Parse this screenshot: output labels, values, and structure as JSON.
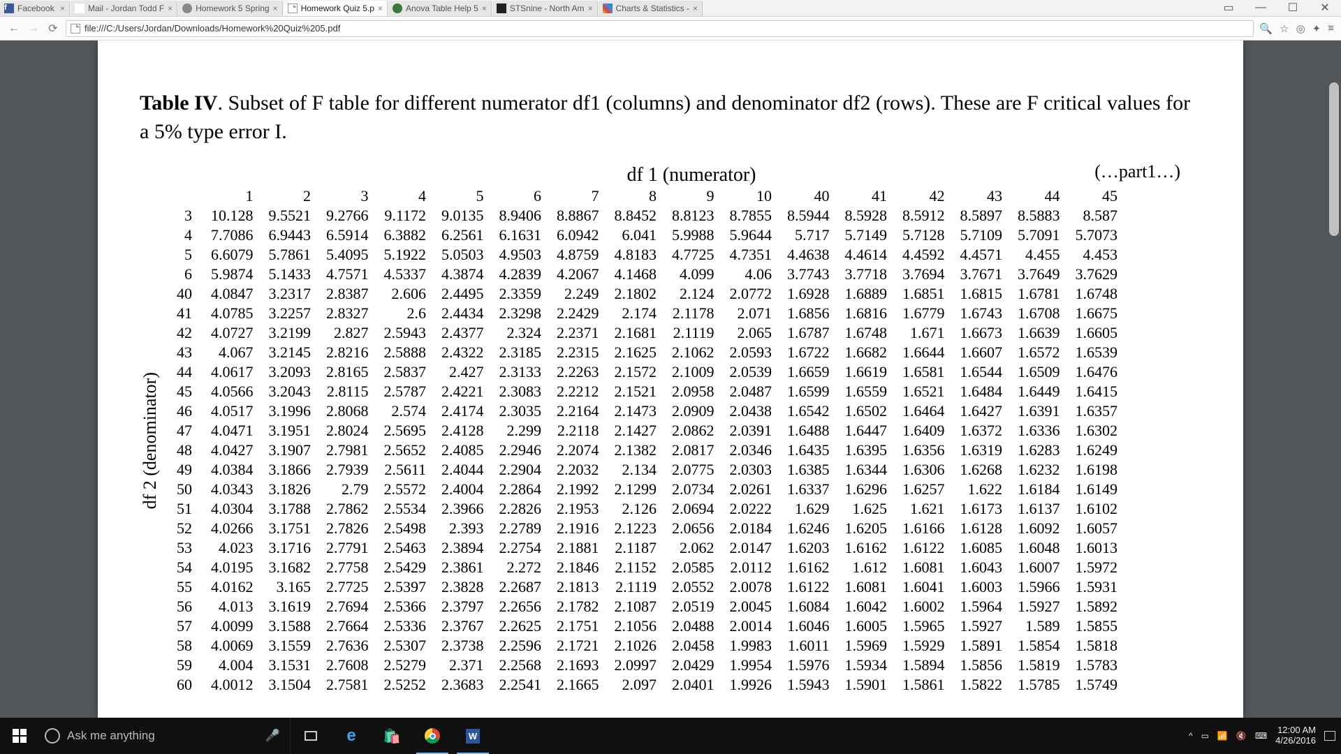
{
  "browser": {
    "tabs": [
      {
        "label": "Facebook",
        "icon": "facebook"
      },
      {
        "label": "Mail - Jordan Todd F",
        "icon": "mail"
      },
      {
        "label": "Homework 5 Spring",
        "icon": "gear"
      },
      {
        "label": "Homework Quiz 5.p",
        "icon": "page",
        "active": true
      },
      {
        "label": "Anova Table Help 5",
        "icon": "chegg"
      },
      {
        "label": "STSnine - North Am",
        "icon": "sts"
      },
      {
        "label": "Charts & Statistics -",
        "icon": "charts"
      }
    ],
    "url": "file:///C:/Users/Jordan/Downloads/Homework%20Quiz%205.pdf"
  },
  "document": {
    "title_bold": "Table IV",
    "title_rest": ". Subset of F table for different numerator df1 (columns) and denominator df2 (rows). These are F critical values for a 5% type error I.",
    "col_axis": "df 1 (numerator)",
    "row_axis": "df 2 (denominator)",
    "part_label": "(…part1…)"
  },
  "chart_data": {
    "type": "table",
    "title": "Subset of F table, 5% critical values",
    "col_headers": [
      "1",
      "2",
      "3",
      "4",
      "5",
      "6",
      "7",
      "8",
      "9",
      "10",
      "40",
      "41",
      "42",
      "43",
      "44",
      "45"
    ],
    "row_headers": [
      "3",
      "4",
      "5",
      "6",
      "40",
      "41",
      "42",
      "43",
      "44",
      "45",
      "46",
      "47",
      "48",
      "49",
      "50",
      "51",
      "52",
      "53",
      "54",
      "55",
      "56",
      "57",
      "58",
      "59",
      "60"
    ],
    "values": [
      [
        "10.128",
        "9.5521",
        "9.2766",
        "9.1172",
        "9.0135",
        "8.9406",
        "8.8867",
        "8.8452",
        "8.8123",
        "8.7855",
        "8.5944",
        "8.5928",
        "8.5912",
        "8.5897",
        "8.5883",
        "8.587"
      ],
      [
        "7.7086",
        "6.9443",
        "6.5914",
        "6.3882",
        "6.2561",
        "6.1631",
        "6.0942",
        "6.041",
        "5.9988",
        "5.9644",
        "5.717",
        "5.7149",
        "5.7128",
        "5.7109",
        "5.7091",
        "5.7073"
      ],
      [
        "6.6079",
        "5.7861",
        "5.4095",
        "5.1922",
        "5.0503",
        "4.9503",
        "4.8759",
        "4.8183",
        "4.7725",
        "4.7351",
        "4.4638",
        "4.4614",
        "4.4592",
        "4.4571",
        "4.455",
        "4.453"
      ],
      [
        "5.9874",
        "5.1433",
        "4.7571",
        "4.5337",
        "4.3874",
        "4.2839",
        "4.2067",
        "4.1468",
        "4.099",
        "4.06",
        "3.7743",
        "3.7718",
        "3.7694",
        "3.7671",
        "3.7649",
        "3.7629"
      ],
      [
        "4.0847",
        "3.2317",
        "2.8387",
        "2.606",
        "2.4495",
        "2.3359",
        "2.249",
        "2.1802",
        "2.124",
        "2.0772",
        "1.6928",
        "1.6889",
        "1.6851",
        "1.6815",
        "1.6781",
        "1.6748"
      ],
      [
        "4.0785",
        "3.2257",
        "2.8327",
        "2.6",
        "2.4434",
        "2.3298",
        "2.2429",
        "2.174",
        "2.1178",
        "2.071",
        "1.6856",
        "1.6816",
        "1.6779",
        "1.6743",
        "1.6708",
        "1.6675"
      ],
      [
        "4.0727",
        "3.2199",
        "2.827",
        "2.5943",
        "2.4377",
        "2.324",
        "2.2371",
        "2.1681",
        "2.1119",
        "2.065",
        "1.6787",
        "1.6748",
        "1.671",
        "1.6673",
        "1.6639",
        "1.6605"
      ],
      [
        "4.067",
        "3.2145",
        "2.8216",
        "2.5888",
        "2.4322",
        "2.3185",
        "2.2315",
        "2.1625",
        "2.1062",
        "2.0593",
        "1.6722",
        "1.6682",
        "1.6644",
        "1.6607",
        "1.6572",
        "1.6539"
      ],
      [
        "4.0617",
        "3.2093",
        "2.8165",
        "2.5837",
        "2.427",
        "2.3133",
        "2.2263",
        "2.1572",
        "2.1009",
        "2.0539",
        "1.6659",
        "1.6619",
        "1.6581",
        "1.6544",
        "1.6509",
        "1.6476"
      ],
      [
        "4.0566",
        "3.2043",
        "2.8115",
        "2.5787",
        "2.4221",
        "2.3083",
        "2.2212",
        "2.1521",
        "2.0958",
        "2.0487",
        "1.6599",
        "1.6559",
        "1.6521",
        "1.6484",
        "1.6449",
        "1.6415"
      ],
      [
        "4.0517",
        "3.1996",
        "2.8068",
        "2.574",
        "2.4174",
        "2.3035",
        "2.2164",
        "2.1473",
        "2.0909",
        "2.0438",
        "1.6542",
        "1.6502",
        "1.6464",
        "1.6427",
        "1.6391",
        "1.6357"
      ],
      [
        "4.0471",
        "3.1951",
        "2.8024",
        "2.5695",
        "2.4128",
        "2.299",
        "2.2118",
        "2.1427",
        "2.0862",
        "2.0391",
        "1.6488",
        "1.6447",
        "1.6409",
        "1.6372",
        "1.6336",
        "1.6302"
      ],
      [
        "4.0427",
        "3.1907",
        "2.7981",
        "2.5652",
        "2.4085",
        "2.2946",
        "2.2074",
        "2.1382",
        "2.0817",
        "2.0346",
        "1.6435",
        "1.6395",
        "1.6356",
        "1.6319",
        "1.6283",
        "1.6249"
      ],
      [
        "4.0384",
        "3.1866",
        "2.7939",
        "2.5611",
        "2.4044",
        "2.2904",
        "2.2032",
        "2.134",
        "2.0775",
        "2.0303",
        "1.6385",
        "1.6344",
        "1.6306",
        "1.6268",
        "1.6232",
        "1.6198"
      ],
      [
        "4.0343",
        "3.1826",
        "2.79",
        "2.5572",
        "2.4004",
        "2.2864",
        "2.1992",
        "2.1299",
        "2.0734",
        "2.0261",
        "1.6337",
        "1.6296",
        "1.6257",
        "1.622",
        "1.6184",
        "1.6149"
      ],
      [
        "4.0304",
        "3.1788",
        "2.7862",
        "2.5534",
        "2.3966",
        "2.2826",
        "2.1953",
        "2.126",
        "2.0694",
        "2.0222",
        "1.629",
        "1.625",
        "1.621",
        "1.6173",
        "1.6137",
        "1.6102"
      ],
      [
        "4.0266",
        "3.1751",
        "2.7826",
        "2.5498",
        "2.393",
        "2.2789",
        "2.1916",
        "2.1223",
        "2.0656",
        "2.0184",
        "1.6246",
        "1.6205",
        "1.6166",
        "1.6128",
        "1.6092",
        "1.6057"
      ],
      [
        "4.023",
        "3.1716",
        "2.7791",
        "2.5463",
        "2.3894",
        "2.2754",
        "2.1881",
        "2.1187",
        "2.062",
        "2.0147",
        "1.6203",
        "1.6162",
        "1.6122",
        "1.6085",
        "1.6048",
        "1.6013"
      ],
      [
        "4.0195",
        "3.1682",
        "2.7758",
        "2.5429",
        "2.3861",
        "2.272",
        "2.1846",
        "2.1152",
        "2.0585",
        "2.0112",
        "1.6162",
        "1.612",
        "1.6081",
        "1.6043",
        "1.6007",
        "1.5972"
      ],
      [
        "4.0162",
        "3.165",
        "2.7725",
        "2.5397",
        "2.3828",
        "2.2687",
        "2.1813",
        "2.1119",
        "2.0552",
        "2.0078",
        "1.6122",
        "1.6081",
        "1.6041",
        "1.6003",
        "1.5966",
        "1.5931"
      ],
      [
        "4.013",
        "3.1619",
        "2.7694",
        "2.5366",
        "2.3797",
        "2.2656",
        "2.1782",
        "2.1087",
        "2.0519",
        "2.0045",
        "1.6084",
        "1.6042",
        "1.6002",
        "1.5964",
        "1.5927",
        "1.5892"
      ],
      [
        "4.0099",
        "3.1588",
        "2.7664",
        "2.5336",
        "2.3767",
        "2.2625",
        "2.1751",
        "2.1056",
        "2.0488",
        "2.0014",
        "1.6046",
        "1.6005",
        "1.5965",
        "1.5927",
        "1.589",
        "1.5855"
      ],
      [
        "4.0069",
        "3.1559",
        "2.7636",
        "2.5307",
        "2.3738",
        "2.2596",
        "2.1721",
        "2.1026",
        "2.0458",
        "1.9983",
        "1.6011",
        "1.5969",
        "1.5929",
        "1.5891",
        "1.5854",
        "1.5818"
      ],
      [
        "4.004",
        "3.1531",
        "2.7608",
        "2.5279",
        "2.371",
        "2.2568",
        "2.1693",
        "2.0997",
        "2.0429",
        "1.9954",
        "1.5976",
        "1.5934",
        "1.5894",
        "1.5856",
        "1.5819",
        "1.5783"
      ],
      [
        "4.0012",
        "3.1504",
        "2.7581",
        "2.5252",
        "2.3683",
        "2.2541",
        "2.1665",
        "2.097",
        "2.0401",
        "1.9926",
        "1.5943",
        "1.5901",
        "1.5861",
        "1.5822",
        "1.5785",
        "1.5749"
      ]
    ]
  },
  "taskbar": {
    "search_placeholder": "Ask me anything",
    "time": "12:00 AM",
    "date": "4/26/2016"
  }
}
